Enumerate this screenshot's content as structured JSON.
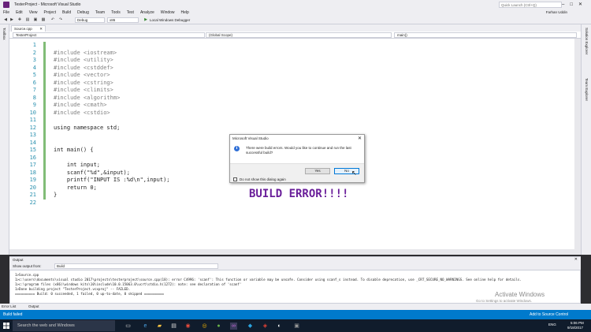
{
  "window": {
    "title": "TesterProject - Microsoft Visual Studio",
    "quick_launch": "Quick Launch (Ctrl+Q)"
  },
  "menu": {
    "items": [
      "File",
      "Edit",
      "View",
      "Project",
      "Build",
      "Debug",
      "Team",
      "Tools",
      "Test",
      "Analyze",
      "Window",
      "Help"
    ],
    "user": "Farhan Uddin"
  },
  "toolbar": {
    "config": "Debug",
    "platform": "x86",
    "debugger": "Local Windows Debugger"
  },
  "side": {
    "left": "Toolbox",
    "right1": "Solution Explorer",
    "right2": "Team Explorer"
  },
  "editor": {
    "tab": "Source.cpp",
    "nav_project": "TesterProject",
    "nav_scope": "(Global Scope)",
    "nav_func": "main()",
    "lines": [
      {
        "n": "1",
        "t": ""
      },
      {
        "n": "2",
        "t": "#include <iostream>"
      },
      {
        "n": "3",
        "t": "#include <utility>"
      },
      {
        "n": "4",
        "t": "#include <cstddef>"
      },
      {
        "n": "5",
        "t": "#include <vector>"
      },
      {
        "n": "6",
        "t": "#include <cstring>"
      },
      {
        "n": "7",
        "t": "#include <climits>"
      },
      {
        "n": "8",
        "t": "#include <algorithm>"
      },
      {
        "n": "9",
        "t": "#include <cmath>"
      },
      {
        "n": "10",
        "t": "#include <cstdio>"
      },
      {
        "n": "11",
        "t": ""
      },
      {
        "n": "12",
        "t": "using namespace std;"
      },
      {
        "n": "13",
        "t": ""
      },
      {
        "n": "14",
        "t": ""
      },
      {
        "n": "15",
        "t": "int main() {"
      },
      {
        "n": "16",
        "t": ""
      },
      {
        "n": "17",
        "t": "    int input;"
      },
      {
        "n": "18",
        "t": "    scanf(\"%d\",&input);"
      },
      {
        "n": "19",
        "t": "    printf(\"INPUT IS :%d\\n\",input);"
      },
      {
        "n": "20",
        "t": "    return 0;"
      },
      {
        "n": "21",
        "t": "}"
      },
      {
        "n": "22",
        "t": ""
      }
    ],
    "annotation": "BUILD ERROR!!!!"
  },
  "dialog": {
    "title": "Microsoft Visual Studio",
    "message": "There were build errors. Would you like to continue and run the last successful build?",
    "yes": "Yes",
    "no": "No",
    "checkbox": "Do not show this dialog again"
  },
  "output": {
    "title": "Output",
    "show_from_label": "Show output from:",
    "show_from_value": "Build",
    "lines": [
      "1>Source.cpp",
      "1>c:\\users\\documents\\visual studio 2017\\projects\\testerproject\\source.cpp(18): error C4996: 'scanf': This function or variable may be unsafe. Consider using scanf_s instead. To disable deprecation, use _CRT_SECURE_NO_WARNINGS. See online help for details.",
      "1>c:\\program files (x86)\\windows kits\\10\\include\\10.0.15063.0\\ucrt\\stdio.h(1272): note: see declaration of 'scanf'",
      "1>Done building project \"TesterProject.vcxproj\" -- FAILED.",
      "========== Build: 0 succeeded, 1 failed, 0 up-to-date, 0 skipped =========="
    ]
  },
  "bottom_tabs": [
    "Error List",
    "Output"
  ],
  "watermark": {
    "line1": "Activate Windows",
    "line2": "Go to Settings to activate Windows."
  },
  "status": {
    "left": "Build failed",
    "right": "Add to Source Control"
  },
  "taskbar": {
    "search": "Search the web and Windows",
    "time": "5:06 PM",
    "date": "9/18/2017",
    "lang": "ENG"
  },
  "colors": {
    "accent": "#007acc",
    "annotation": "#6a1f9a",
    "keyword": "#0000ff",
    "string": "#a31515"
  }
}
